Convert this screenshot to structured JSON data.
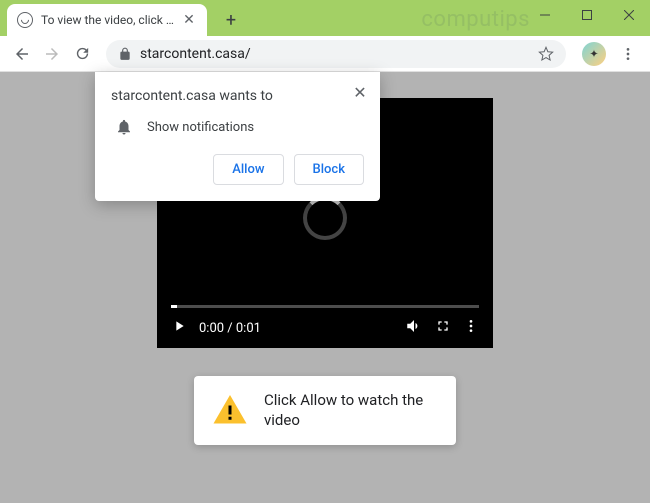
{
  "titlebar": {
    "tab_title": "To view the video, click the Allow",
    "watermark": "computips"
  },
  "toolbar": {
    "url": "starcontent.casa/"
  },
  "permission": {
    "header": "starcontent.casa wants to",
    "label": "Show notifications",
    "allow": "Allow",
    "block": "Block"
  },
  "video": {
    "time": "0:00 / 0:01"
  },
  "message": {
    "text": "Click Allow to watch the video"
  }
}
